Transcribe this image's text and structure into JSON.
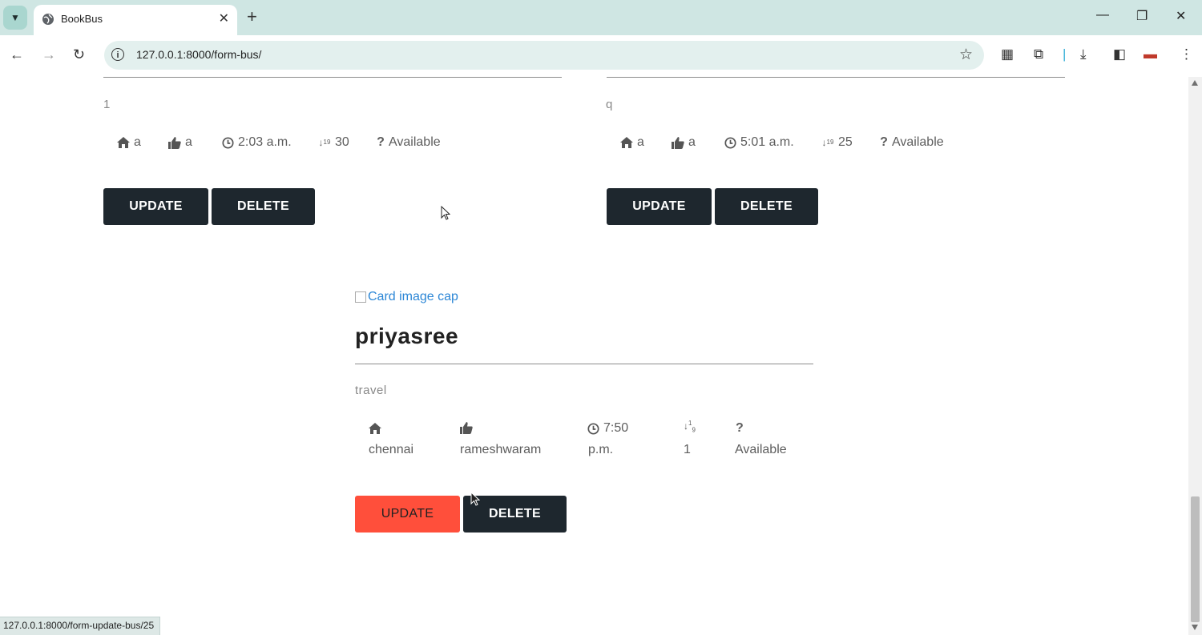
{
  "browser": {
    "tab_title": "BookBus",
    "url": "127.0.0.1:8000/form-bus/",
    "status_url": "127.0.0.1:8000/form-update-bus/25"
  },
  "cards_top": [
    {
      "subtitle": "1",
      "from": "a",
      "to": "a",
      "time": "2:03 a.m.",
      "seats": "30",
      "status": "Available",
      "update_label": "UPDATE",
      "delete_label": "DELETE"
    },
    {
      "subtitle": "q",
      "from": "a",
      "to": "a",
      "time": "5:01 a.m.",
      "seats": "25",
      "status": "Available",
      "update_label": "UPDATE",
      "delete_label": "DELETE"
    }
  ],
  "card_main": {
    "image_alt": "Card image cap",
    "title": "priyasree",
    "subtitle": "travel",
    "from": "chennai",
    "to": "rameshwaram",
    "time_line1": "7:50",
    "time_line2": "p.m.",
    "seats": "1",
    "status": "Available",
    "update_label": "UPDATE",
    "delete_label": "DELETE"
  },
  "colors": {
    "accent": "#ff4f3b",
    "dark_button": "#1e272e",
    "chrome": "#cfe6e3"
  }
}
